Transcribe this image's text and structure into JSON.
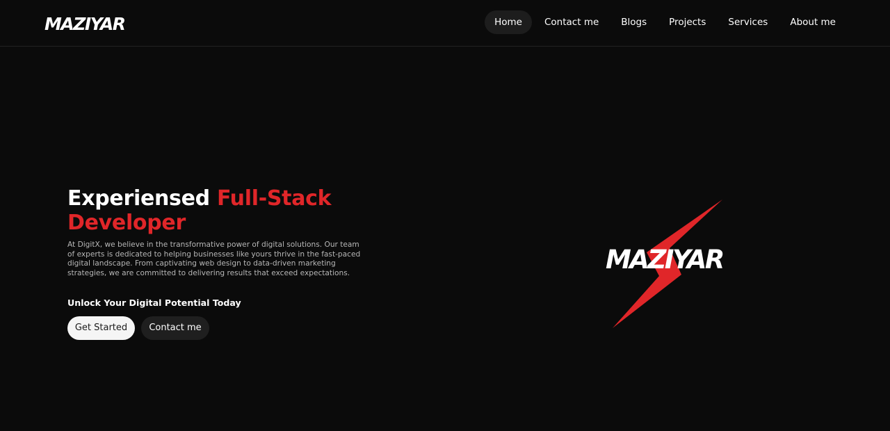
{
  "brand": {
    "name": "MAZIYAR"
  },
  "nav": {
    "items": [
      {
        "label": "Home",
        "active": true
      },
      {
        "label": "Contact me",
        "active": false
      },
      {
        "label": "Blogs",
        "active": false
      },
      {
        "label": "Projects",
        "active": false
      },
      {
        "label": "Services",
        "active": false
      },
      {
        "label": "About me",
        "active": false
      }
    ]
  },
  "hero": {
    "title_plain": "Experiensed ",
    "title_accent_1": "Full-Stack",
    "title_accent_2": "Developer",
    "description": "At DigitX, we believe in the transformative power of digital solutions. Our team of experts is dedicated to helping businesses like yours thrive in the fast-paced digital landscape. From captivating web design to data-driven marketing strategies, we are committed to delivering results that exceed expectations.",
    "subheading": "Unlock Your Digital Potential Today",
    "primary_button": "Get Started",
    "secondary_button": "Contact me"
  },
  "colors": {
    "background": "#0b0b0b",
    "accent": "#e02629",
    "nav_active_bg": "#1d1d1d",
    "text_muted": "#b7b7b7"
  },
  "icons": {
    "hero_graphic": "lightning-bolt-logo"
  }
}
